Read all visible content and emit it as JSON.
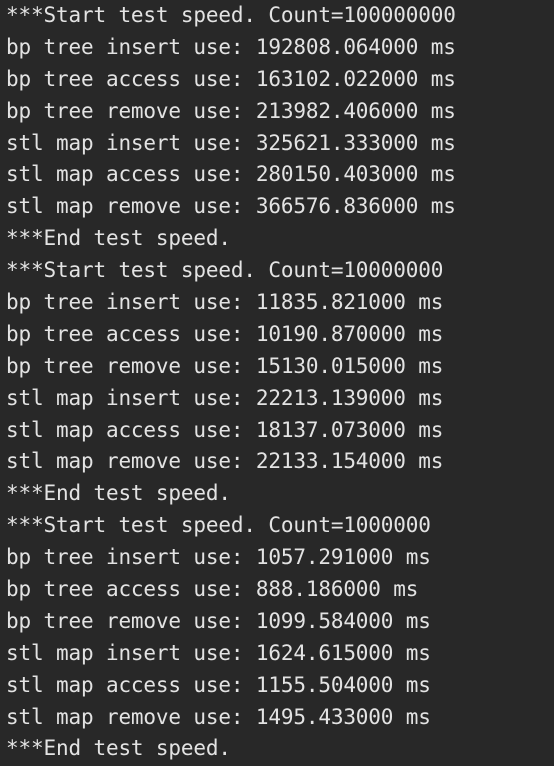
{
  "terminal": {
    "lines": [
      "***Start test speed. Count=100000000",
      "bp tree insert use: 192808.064000 ms",
      "bp tree access use: 163102.022000 ms",
      "bp tree remove use: 213982.406000 ms",
      "stl map insert use: 325621.333000 ms",
      "stl map access use: 280150.403000 ms",
      "stl map remove use: 366576.836000 ms",
      "***End test speed.",
      "***Start test speed. Count=10000000",
      "bp tree insert use: 11835.821000 ms",
      "bp tree access use: 10190.870000 ms",
      "bp tree remove use: 15130.015000 ms",
      "stl map insert use: 22213.139000 ms",
      "stl map access use: 18137.073000 ms",
      "stl map remove use: 22133.154000 ms",
      "***End test speed.",
      "***Start test speed. Count=1000000",
      "bp tree insert use: 1057.291000 ms",
      "bp tree access use: 888.186000 ms",
      "bp tree remove use: 1099.584000 ms",
      "stl map insert use: 1624.615000 ms",
      "stl map access use: 1155.504000 ms",
      "stl map remove use: 1495.433000 ms",
      "***End test speed."
    ]
  }
}
